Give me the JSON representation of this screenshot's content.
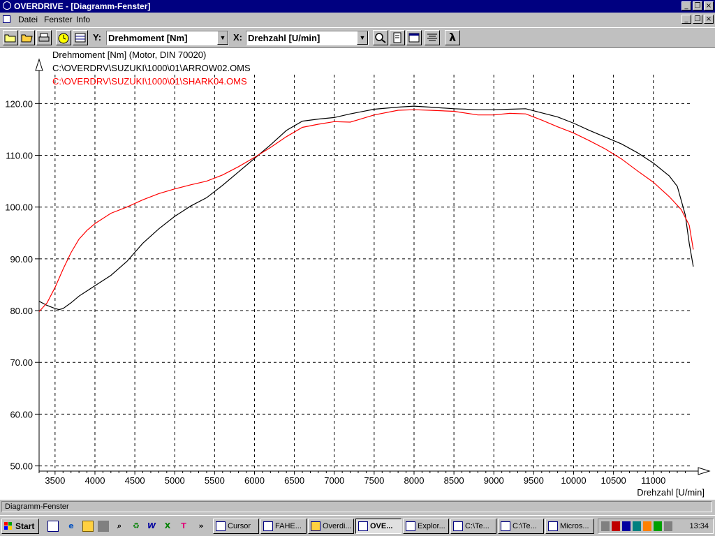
{
  "window": {
    "title": "OVERDRIVE - [Diagramm-Fenster]"
  },
  "menu": {
    "items": [
      "Datei",
      "Fenster",
      "Info"
    ]
  },
  "toolbar": {
    "y_label": "Y:",
    "y_value": "Drehmoment [Nm]",
    "x_label": "X:",
    "x_value": "Drehzahl [U/min]",
    "lambda_label": "λ"
  },
  "chart_data": {
    "type": "line",
    "title": "Drehmoment [Nm] (Motor, DIN 70020)",
    "xlabel": "Drehzahl [U/min]",
    "ylabel": "",
    "xlim": [
      3300,
      11650
    ],
    "ylim": [
      49,
      128
    ],
    "xticks": [
      3500,
      4000,
      4500,
      5000,
      5500,
      6000,
      6500,
      7000,
      7500,
      8000,
      8500,
      9000,
      9500,
      10000,
      10500,
      11000
    ],
    "xtick_labels": [
      "3500",
      "4000",
      "4500",
      "5000",
      "5500",
      "6000",
      "6500",
      "7000",
      "7500",
      "8000",
      "8500",
      "9000",
      "9500",
      "10000",
      "10500",
      "11000"
    ],
    "yticks": [
      50,
      60,
      70,
      80,
      90,
      100,
      110,
      120
    ],
    "ytick_labels": [
      "50.00",
      "60.00",
      "70.00",
      "80.00",
      "90.00",
      "100.00",
      "110.00",
      "120.00"
    ],
    "grid": true,
    "series": [
      {
        "name": "C:\\OVERDRV\\SUZUKI\\1000\\01\\ARROW02.OMS",
        "color": "#000000",
        "x": [
          3300,
          3400,
          3500,
          3550,
          3600,
          3700,
          3800,
          4000,
          4200,
          4400,
          4600,
          4800,
          5000,
          5200,
          5400,
          5600,
          5800,
          6000,
          6200,
          6400,
          6600,
          6800,
          7000,
          7200,
          7500,
          7800,
          8000,
          8200,
          8500,
          8800,
          9000,
          9200,
          9400,
          9600,
          9800,
          10000,
          10200,
          10400,
          10600,
          10800,
          11000,
          11200,
          11300,
          11400,
          11450,
          11500
        ],
        "y": [
          81.8,
          81.0,
          80.4,
          80.2,
          80.4,
          81.5,
          82.8,
          84.8,
          86.8,
          89.5,
          93.0,
          95.8,
          98.2,
          100.2,
          101.8,
          104.2,
          106.8,
          109.4,
          112.0,
          114.8,
          116.6,
          117.0,
          117.3,
          118.0,
          118.9,
          119.3,
          119.5,
          119.3,
          119.0,
          118.8,
          118.8,
          118.9,
          119.0,
          118.2,
          117.4,
          116.2,
          114.8,
          113.5,
          112.2,
          110.5,
          108.5,
          106.0,
          104.0,
          98.5,
          93.0,
          88.5
        ]
      },
      {
        "name": "C:\\OVERDRV\\SUZUKI\\1000\\01\\SHARK04.OMS",
        "color": "#ff0000",
        "x": [
          3300,
          3400,
          3500,
          3600,
          3700,
          3800,
          3900,
          4000,
          4200,
          4400,
          4600,
          4800,
          5000,
          5200,
          5400,
          5600,
          5800,
          6000,
          6200,
          6400,
          6600,
          6800,
          7000,
          7200,
          7500,
          7800,
          8000,
          8200,
          8500,
          8800,
          9000,
          9200,
          9400,
          9600,
          9800,
          10000,
          10200,
          10400,
          10600,
          10800,
          11000,
          11200,
          11350,
          11450,
          11500
        ],
        "y": [
          79.8,
          81.5,
          84.5,
          88.0,
          91.2,
          93.8,
          95.5,
          96.8,
          98.8,
          100.0,
          101.4,
          102.6,
          103.5,
          104.3,
          105.0,
          106.2,
          107.8,
          109.6,
          111.5,
          113.6,
          115.4,
          116.0,
          116.5,
          116.4,
          117.8,
          118.7,
          118.8,
          118.7,
          118.5,
          117.8,
          117.8,
          118.1,
          118.0,
          116.8,
          115.5,
          114.3,
          112.8,
          111.2,
          109.3,
          107.0,
          104.8,
          102.0,
          99.5,
          96.5,
          91.8
        ]
      }
    ]
  },
  "statusbar": {
    "text": "Diagramm-Fenster"
  },
  "taskbar": {
    "start_label": "Start",
    "chevron": "»",
    "tasks": [
      "Cursor",
      "FAHE...",
      "Overdi...",
      "OVE...",
      "Explor...",
      "C:\\Te...",
      "C:\\Te...",
      "Micros..."
    ],
    "clock": "13:34"
  }
}
